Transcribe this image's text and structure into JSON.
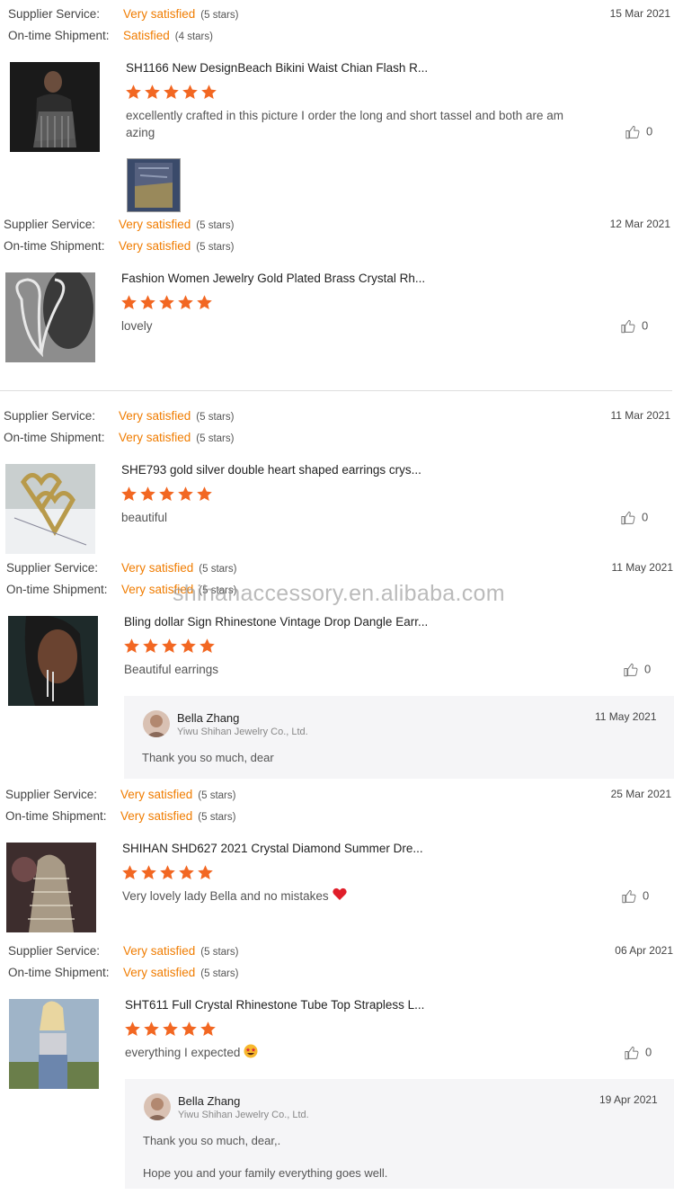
{
  "watermark": "shihanaccessory.en.alibaba.com",
  "colors": {
    "accent": "#f07c00",
    "star": "#f26722"
  },
  "icons": {
    "star": "star-icon",
    "like": "thumbs-up-icon",
    "heart": "heart-emoji-icon",
    "starstruck": "star-struck-emoji-icon"
  },
  "labels": {
    "supplier": "Supplier Service:",
    "shipment": "On-time Shipment:"
  },
  "reviews": [
    {
      "supplier_value": "Very satisfied",
      "supplier_stars": "(5 stars)",
      "shipment_value": "Satisfied",
      "shipment_stars": "(4 stars)",
      "date": "15 Mar 2021",
      "product": "SH1166 New DesignBeach Bikini Waist Chian Flash R...",
      "rating": 5,
      "text": "excellently crafted in this picture I order the long and short tassel and both are am azing",
      "likes": "0"
    },
    {
      "supplier_value": "Very satisfied",
      "supplier_stars": "(5 stars)",
      "shipment_value": "Very satisfied",
      "shipment_stars": "(5 stars)",
      "date": "12 Mar 2021",
      "product": "Fashion Women Jewelry Gold Plated Brass Crystal Rh...",
      "rating": 5,
      "text": "lovely",
      "likes": "0"
    },
    {
      "supplier_value": "Very satisfied",
      "supplier_stars": "(5 stars)",
      "shipment_value": "Very satisfied",
      "shipment_stars": "(5 stars)",
      "date": "11 Mar 2021",
      "product": "SHE793 gold silver double heart shaped earrings crys...",
      "rating": 5,
      "text": "beautiful",
      "likes": "0"
    },
    {
      "supplier_value": "Very satisfied",
      "supplier_stars": "(5 stars)",
      "shipment_value": "Very satisfied",
      "shipment_stars": "(5 stars)",
      "date": "11 May 2021",
      "product": "Bling dollar Sign Rhinestone Vintage Drop Dangle Earr...",
      "rating": 5,
      "text": "Beautiful earrings",
      "likes": "0",
      "reply": {
        "name": "Bella Zhang",
        "company": "Yiwu Shihan Jewelry Co., Ltd.",
        "date": "11 May 2021",
        "lines": [
          "Thank you so much, dear"
        ]
      }
    },
    {
      "supplier_value": "Very satisfied",
      "supplier_stars": "(5 stars)",
      "shipment_value": "Very satisfied",
      "shipment_stars": "(5 stars)",
      "date": "25 Mar 2021",
      "product": "SHIHAN SHD627 2021 Crystal Diamond Summer Dre...",
      "rating": 5,
      "text": "Very lovely lady Bella and no mistakes",
      "likes": "0"
    },
    {
      "supplier_value": "Very satisfied",
      "supplier_stars": "(5 stars)",
      "shipment_value": "Very satisfied",
      "shipment_stars": "(5 stars)",
      "date": "06 Apr 2021",
      "product": "SHT611 Full Crystal Rhinestone Tube Top Strapless L...",
      "rating": 5,
      "text": "everything I expected",
      "likes": "0",
      "reply": {
        "name": "Bella Zhang",
        "company": "Yiwu Shihan Jewelry Co., Ltd.",
        "date": "19 Apr 2021",
        "lines": [
          "Thank you so much, dear,.",
          "Hope you and your family everything goes well."
        ]
      }
    }
  ]
}
